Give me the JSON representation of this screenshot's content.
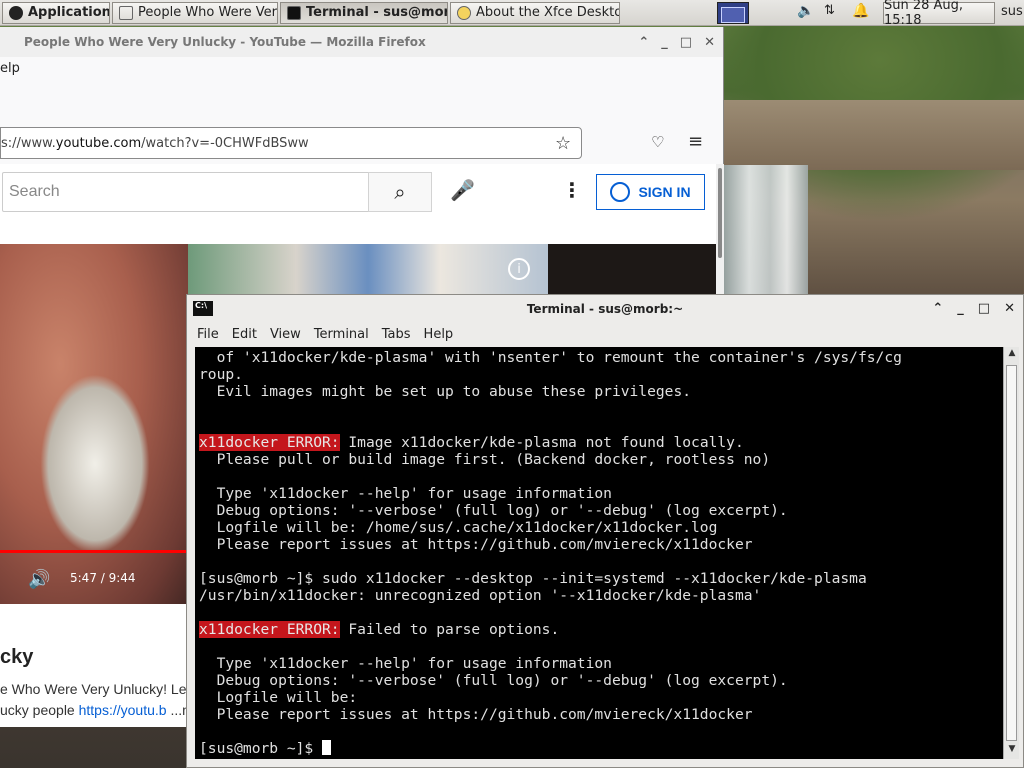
{
  "panel": {
    "applications_label": "Applications",
    "tasks": [
      {
        "label": "People Who Were Very..."
      },
      {
        "label": "Terminal - sus@mor..."
      },
      {
        "label": "About the Xfce Deskto..."
      }
    ],
    "clock": "Sun 28 Aug, 15:18",
    "user": "sus"
  },
  "firefox": {
    "title": "People Who Were Very Unlucky - YouTube — Mozilla Firefox",
    "menu_visible": "elp",
    "url_prefix": "s://www.",
    "url_domain": "youtube.com",
    "url_path": "/watch?v=-0CHWFdBSww"
  },
  "youtube": {
    "search_placeholder": "Search",
    "signin_label": "SIGN IN",
    "time": "5:47 / 9:44",
    "title_visible": "cky",
    "desc_line1": "e Who Were Very Unlucky! Leav",
    "desc_line2_prefix": "ucky people ",
    "desc_line2_link": "https://youtu.b",
    "desc_line2_more": "...m",
    "info_glyph": "i"
  },
  "terminal": {
    "title": "Terminal - sus@morb:~",
    "icon_text": "C:\\",
    "menu": [
      "File",
      "Edit",
      "View",
      "Terminal",
      "Tabs",
      "Help"
    ],
    "lines": [
      [
        {
          "t": "  of 'x11docker/kde-plasma' with 'nsenter' to remount the container's /sys/fs/cg"
        }
      ],
      [
        {
          "t": "roup."
        }
      ],
      [
        {
          "t": "  Evil images might be set up to abuse these privileges."
        }
      ],
      [
        {
          "t": ""
        }
      ],
      [
        {
          "t": ""
        }
      ],
      [
        {
          "t": "x11docker ERROR:",
          "err": true
        },
        {
          "t": " Image x11docker/kde-plasma not found locally."
        }
      ],
      [
        {
          "t": "  Please pull or build image first. (Backend docker, rootless no)"
        }
      ],
      [
        {
          "t": ""
        }
      ],
      [
        {
          "t": "  Type 'x11docker --help' for usage information"
        }
      ],
      [
        {
          "t": "  Debug options: '--verbose' (full log) or '--debug' (log excerpt)."
        }
      ],
      [
        {
          "t": "  Logfile will be: /home/sus/.cache/x11docker/x11docker.log"
        }
      ],
      [
        {
          "t": "  Please report issues at https://github.com/mviereck/x11docker"
        }
      ],
      [
        {
          "t": ""
        }
      ],
      [
        {
          "t": "[sus@morb ~]$ sudo x11docker --desktop --init=systemd --x11docker/kde-plasma"
        }
      ],
      [
        {
          "t": "/usr/bin/x11docker: unrecognized option '--x11docker/kde-plasma'"
        }
      ],
      [
        {
          "t": ""
        }
      ],
      [
        {
          "t": "x11docker ERROR:",
          "err": true
        },
        {
          "t": " Failed to parse options."
        }
      ],
      [
        {
          "t": ""
        }
      ],
      [
        {
          "t": "  Type 'x11docker --help' for usage information"
        }
      ],
      [
        {
          "t": "  Debug options: '--verbose' (full log) or '--debug' (log excerpt)."
        }
      ],
      [
        {
          "t": "  Logfile will be:"
        }
      ],
      [
        {
          "t": "  Please report issues at https://github.com/mviereck/x11docker"
        }
      ],
      [
        {
          "t": ""
        }
      ],
      [
        {
          "t": "[sus@morb ~]$ ",
          "prompt": true
        }
      ]
    ]
  },
  "colors": {
    "error_bg": "#c4161c",
    "yt_blue": "#065fd4",
    "progress_red": "#ff0000"
  }
}
